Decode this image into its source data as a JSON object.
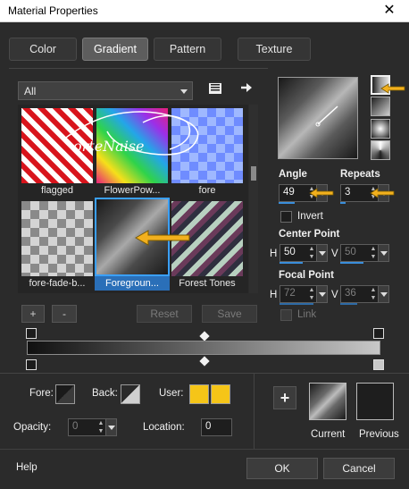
{
  "window": {
    "title": "Material Properties",
    "close_glyph": "✕"
  },
  "tabs": [
    {
      "label": "Color",
      "active": false
    },
    {
      "label": "Gradient",
      "active": true
    },
    {
      "label": "Pattern",
      "active": false
    },
    {
      "label": "Texture",
      "active": false
    }
  ],
  "category_dropdown": {
    "value": "All"
  },
  "gallery": {
    "watermark": "orteNaise",
    "items": [
      {
        "label": "flagged",
        "selected": false
      },
      {
        "label": "FlowerPow...",
        "selected": false
      },
      {
        "label": "fore",
        "selected": false
      },
      {
        "label": "fore-fade-b...",
        "selected": false
      },
      {
        "label": "Foregroun...",
        "selected": true
      },
      {
        "label": "Forest Tones",
        "selected": false
      }
    ]
  },
  "gallery_buttons": {
    "add": "+",
    "remove": "-",
    "reset": "Reset",
    "save": "Save"
  },
  "angle": {
    "label": "Angle",
    "value": "49"
  },
  "repeats": {
    "label": "Repeats",
    "value": "3"
  },
  "invert": {
    "label": "Invert",
    "checked": false
  },
  "center_point": {
    "label": "Center Point",
    "h_label": "H",
    "h_value": "50",
    "v_label": "V",
    "v_value": "50"
  },
  "focal_point": {
    "label": "Focal Point",
    "h_label": "H",
    "h_value": "72",
    "v_label": "V",
    "v_value": "36",
    "enabled": false
  },
  "link": {
    "label": "Link",
    "checked": false,
    "enabled": false
  },
  "fore": {
    "label": "Fore:"
  },
  "back": {
    "label": "Back:"
  },
  "user": {
    "label": "User:",
    "color": "#f5c518"
  },
  "opacity": {
    "label": "Opacity:",
    "value": "0"
  },
  "location": {
    "label": "Location:",
    "value": "0"
  },
  "swatches": {
    "add_glyph": "+",
    "current_label": "Current",
    "previous_label": "Previous"
  },
  "footer": {
    "help": "Help",
    "ok": "OK",
    "cancel": "Cancel"
  },
  "colors": {
    "accent": "#3aa0ff",
    "arrow": "#f2b01e",
    "background": "#2b2b2b"
  }
}
